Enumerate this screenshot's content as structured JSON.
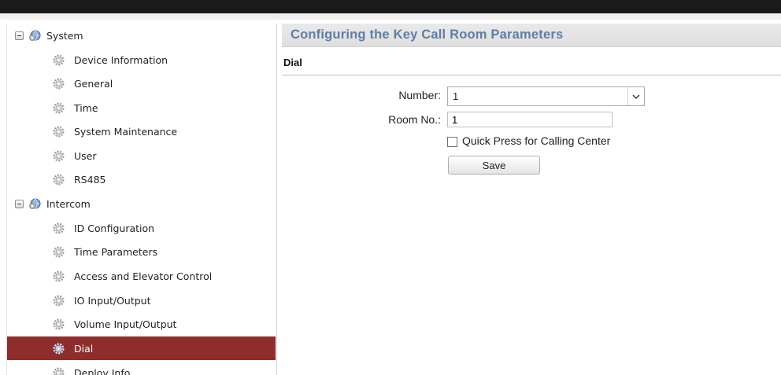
{
  "sidebar": {
    "groups": [
      {
        "label": "System",
        "items": [
          {
            "label": "Device Information"
          },
          {
            "label": "General"
          },
          {
            "label": "Time"
          },
          {
            "label": "System Maintenance"
          },
          {
            "label": "User"
          },
          {
            "label": "RS485"
          }
        ]
      },
      {
        "label": "Intercom",
        "items": [
          {
            "label": "ID Configuration"
          },
          {
            "label": "Time Parameters"
          },
          {
            "label": "Access and Elevator Control"
          },
          {
            "label": "IO Input/Output"
          },
          {
            "label": "Volume Input/Output"
          },
          {
            "label": "Dial",
            "selected": true
          },
          {
            "label": "Deploy Info"
          }
        ]
      }
    ],
    "selected_color": "#8f2d2d"
  },
  "main": {
    "title": "Configuring the Key Call Room Parameters",
    "section": "Dial",
    "form": {
      "number_label": "Number:",
      "number_value": "1",
      "room_label": "Room No.:",
      "room_value": "1",
      "quick_press_label": "Quick Press for Calling Center",
      "quick_press_checked": false,
      "save_label": "Save"
    },
    "title_color": "#5b7fa6"
  }
}
